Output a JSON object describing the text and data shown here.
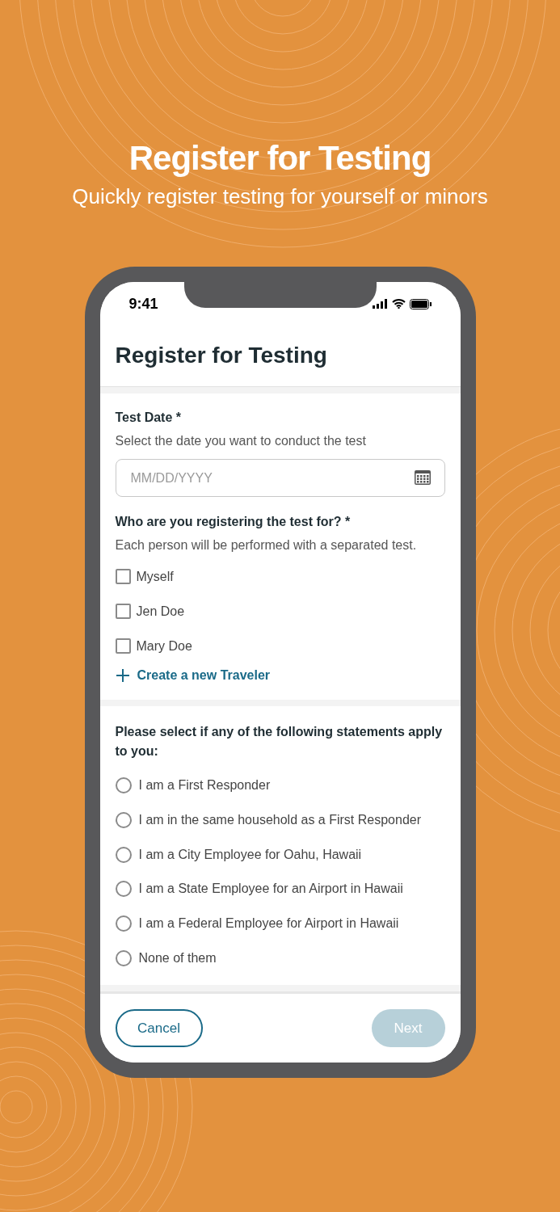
{
  "headline": {
    "title": "Register for Testing",
    "subtitle": "Quickly register testing for yourself or minors"
  },
  "status_bar": {
    "time": "9:41"
  },
  "screen": {
    "title": "Register for Testing"
  },
  "date_field": {
    "label": "Test Date *",
    "hint": "Select the date you want to conduct the test",
    "placeholder": "MM/DD/YYYY"
  },
  "travelers": {
    "label": "Who are you registering the test for? *",
    "hint": "Each person will be performed with a separated test.",
    "options": [
      {
        "label": "Myself",
        "checked": false
      },
      {
        "label": "Jen Doe",
        "checked": false
      },
      {
        "label": "Mary Doe",
        "checked": false
      }
    ],
    "add_link": "Create a new Traveler"
  },
  "statements": {
    "label": "Please select if any of the following statements apply to you:",
    "options": [
      {
        "label": "I am a First Responder",
        "selected": false
      },
      {
        "label": "I am in the same household as a First Responder",
        "selected": false
      },
      {
        "label": "I am a City Employee for Oahu, Hawaii",
        "selected": false
      },
      {
        "label": "I am a State Employee for an Airport in Hawaii",
        "selected": false
      },
      {
        "label": "I am a Federal Employee for Airport in Hawaii",
        "selected": false
      },
      {
        "label": "None of them",
        "selected": false
      }
    ]
  },
  "footer": {
    "cancel": "Cancel",
    "next": {
      "label": "Next",
      "disabled": true
    }
  }
}
